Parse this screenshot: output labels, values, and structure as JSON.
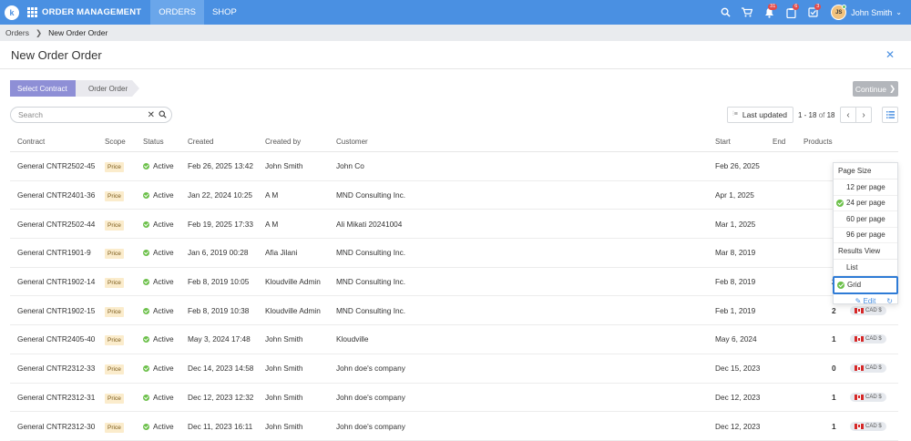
{
  "topbar": {
    "logo": "k",
    "brand": "ORDER MANAGEMENT",
    "tabs": [
      {
        "label": "ORDERS",
        "active": true
      },
      {
        "label": "SHOP",
        "active": false
      }
    ],
    "icons": {
      "search": "search-icon",
      "cart": "cart-icon",
      "notifications": "bell-icon",
      "approvals": "clipboard-icon",
      "tasks": "checklist-icon"
    },
    "badges": {
      "notifications": "31",
      "approvals": "6",
      "tasks": "3"
    },
    "user": {
      "initials": "JS",
      "name": "John Smith"
    }
  },
  "breadcrumb": {
    "parent": "Orders",
    "current": "New Order Order"
  },
  "page": {
    "title": "New Order Order"
  },
  "steps": [
    {
      "label": "Select Contract",
      "active": true
    },
    {
      "label": "Order Order",
      "active": false
    }
  ],
  "continue_label": "Continue",
  "search": {
    "placeholder": "Search",
    "value": ""
  },
  "sort": {
    "label": "Last updated"
  },
  "pagination": {
    "range": "1 - 18",
    "of_label": "of",
    "total": "18"
  },
  "table": {
    "columns": [
      "Contract",
      "Scope",
      "Status",
      "Created",
      "Created by",
      "Customer",
      "Start",
      "End",
      "Products"
    ],
    "rows": [
      {
        "contract": "General CNTR2502-45",
        "scope": "Price",
        "status": "Active",
        "created": "Feb 26, 2025 13:42",
        "created_by": "John Smith",
        "customer": "John Co",
        "start": "Feb 26, 2025",
        "end": "",
        "products": "",
        "currency": ""
      },
      {
        "contract": "General CNTR2401-36",
        "scope": "Price",
        "status": "Active",
        "created": "Jan 22, 2024 10:25",
        "created_by": "A M",
        "customer": "MND Consulting Inc.",
        "start": "Apr 1, 2025",
        "end": "",
        "products": "",
        "currency": ""
      },
      {
        "contract": "General CNTR2502-44",
        "scope": "Price",
        "status": "Active",
        "created": "Feb 19, 2025 17:33",
        "created_by": "A M",
        "customer": "Ali Mikati 20241004",
        "start": "Mar 1, 2025",
        "end": "",
        "products": "",
        "currency": ""
      },
      {
        "contract": "General CNTR1901-9",
        "scope": "Price",
        "status": "Active",
        "created": "Jan 6, 2019 00:28",
        "created_by": "Afia Jilani",
        "customer": "MND Consulting Inc.",
        "start": "Mar 8, 2019",
        "end": "",
        "products": "",
        "currency": ""
      },
      {
        "contract": "General CNTR1902-14",
        "scope": "Price",
        "status": "Active",
        "created": "Feb 8, 2019 10:05",
        "created_by": "Kloudville Admin",
        "customer": "MND Consulting Inc.",
        "start": "Feb 8, 2019",
        "end": "",
        "products": "2",
        "currency": "CAD $"
      },
      {
        "contract": "General CNTR1902-15",
        "scope": "Price",
        "status": "Active",
        "created": "Feb 8, 2019 10:38",
        "created_by": "Kloudville Admin",
        "customer": "MND Consulting Inc.",
        "start": "Feb 1, 2019",
        "end": "",
        "products": "2",
        "currency": "CAD $"
      },
      {
        "contract": "General CNTR2405-40",
        "scope": "Price",
        "status": "Active",
        "created": "May 3, 2024 17:48",
        "created_by": "John Smith",
        "customer": "Kloudville",
        "start": "May 6, 2024",
        "end": "",
        "products": "1",
        "currency": "CAD $"
      },
      {
        "contract": "General CNTR2312-33",
        "scope": "Price",
        "status": "Active",
        "created": "Dec 14, 2023 14:58",
        "created_by": "John Smith",
        "customer": "John doe's company",
        "start": "Dec 15, 2023",
        "end": "",
        "products": "0",
        "currency": "CAD $"
      },
      {
        "contract": "General CNTR2312-31",
        "scope": "Price",
        "status": "Active",
        "created": "Dec 12, 2023 12:32",
        "created_by": "John Smith",
        "customer": "John doe's company",
        "start": "Dec 12, 2023",
        "end": "",
        "products": "1",
        "currency": "CAD $"
      },
      {
        "contract": "General CNTR2312-30",
        "scope": "Price",
        "status": "Active",
        "created": "Dec 11, 2023 16:11",
        "created_by": "John Smith",
        "customer": "John doe's company",
        "start": "Dec 12, 2023",
        "end": "",
        "products": "1",
        "currency": "CAD $"
      }
    ]
  },
  "dropdown": {
    "page_size_label": "Page Size",
    "page_sizes": [
      {
        "label": "12 per page",
        "selected": false
      },
      {
        "label": "24 per page",
        "selected": true
      },
      {
        "label": "60 per page",
        "selected": false
      },
      {
        "label": "96 per page",
        "selected": false
      }
    ],
    "results_view_label": "Results View",
    "views": [
      {
        "label": "List",
        "selected": false
      },
      {
        "label": "Grid",
        "selected": true
      }
    ],
    "edit_label": "Edit"
  },
  "colors": {
    "topbar": "#4a90e2",
    "step_active": "#8e8fd6",
    "status_active": "#6cc04a",
    "price_tag": "#fbeccc",
    "highlight": "#2e7bd6"
  }
}
